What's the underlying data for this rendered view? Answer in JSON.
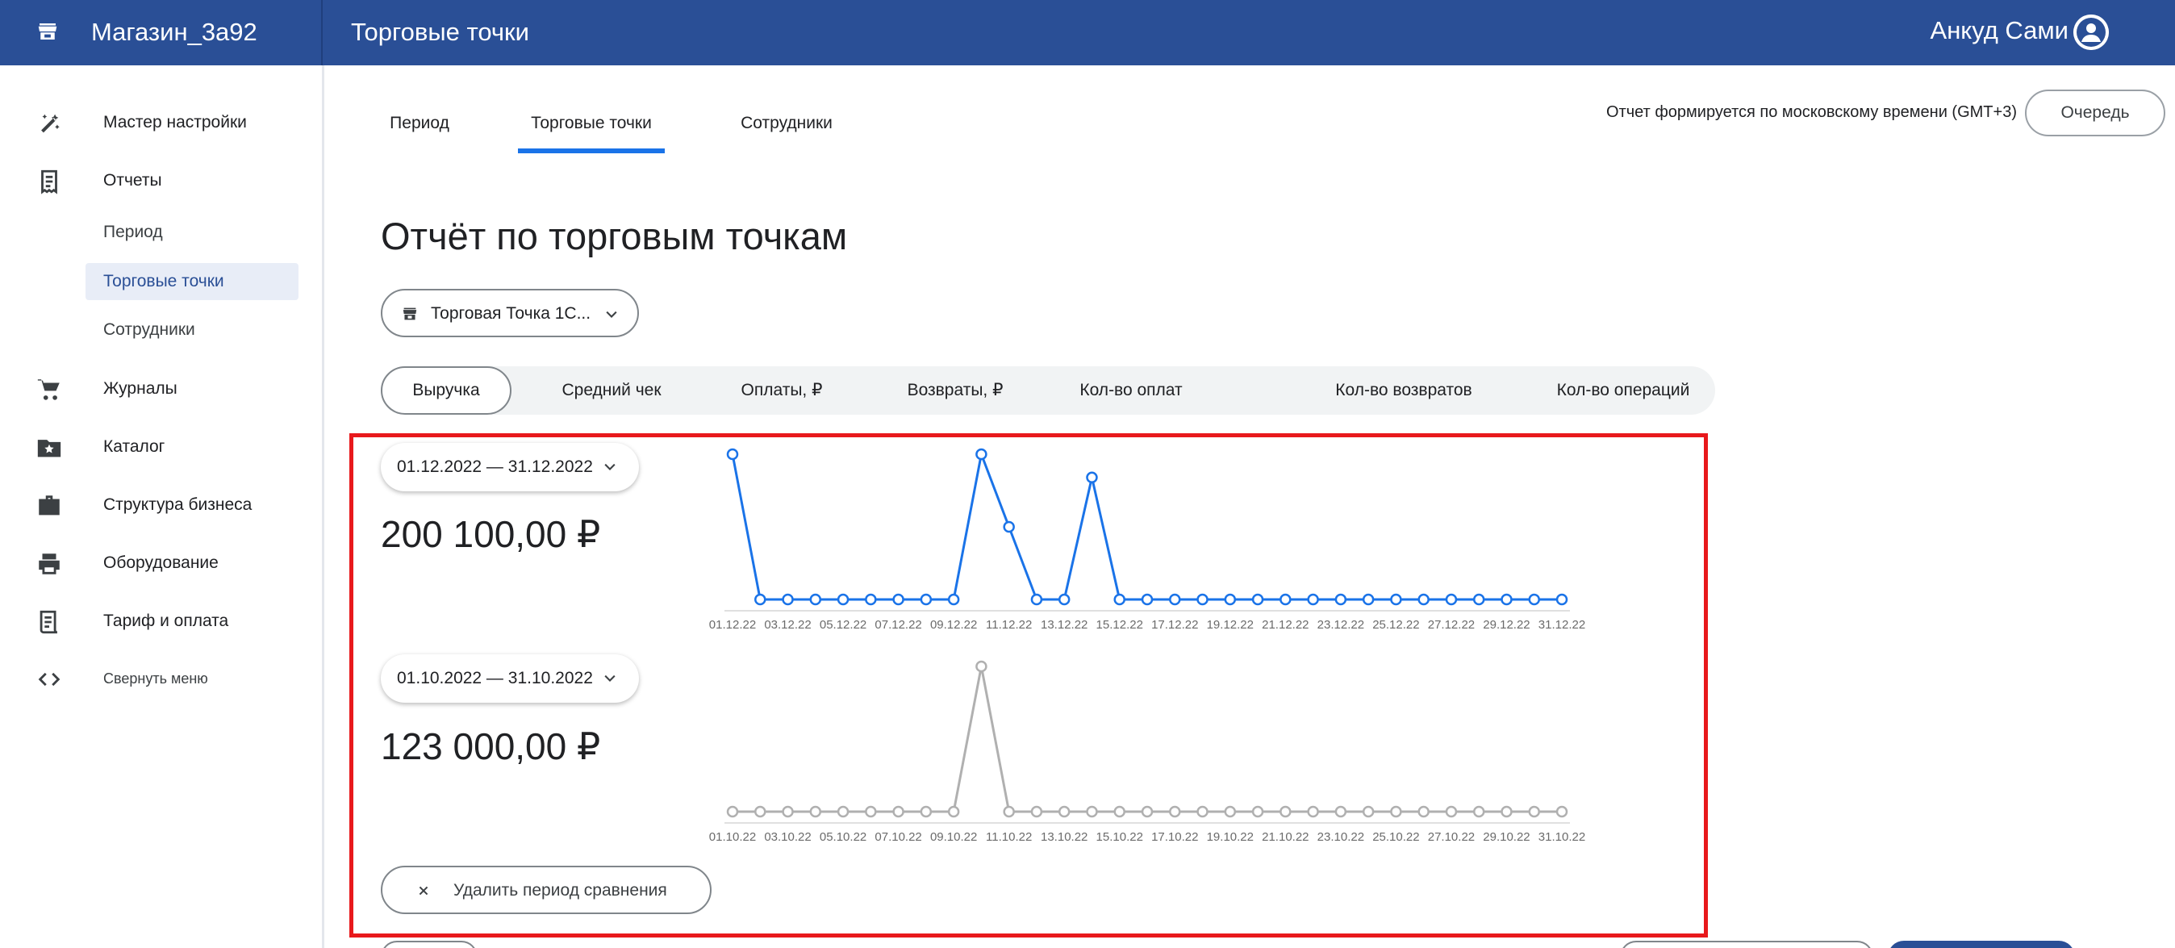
{
  "header": {
    "store_name": "Магазин_3а92",
    "page_title": "Торговые точки",
    "user_name": "Анкуд Сами"
  },
  "sidebar": {
    "items": [
      {
        "label": "Мастер настройки",
        "icon": "magic-wand-icon"
      },
      {
        "label": "Отчеты",
        "icon": "receipt-icon"
      },
      {
        "label": "Журналы",
        "icon": "cart-icon"
      },
      {
        "label": "Каталог",
        "icon": "folder-star-icon"
      },
      {
        "label": "Структура бизнеса",
        "icon": "briefcase-icon"
      },
      {
        "label": "Оборудование",
        "icon": "printer-icon"
      },
      {
        "label": "Тариф и оплата",
        "icon": "invoice-icon"
      }
    ],
    "sub_items": [
      "Период",
      "Торговые точки",
      "Сотрудники"
    ],
    "active_sub_item": "Торговые точки",
    "collapse_label": "Свернуть меню"
  },
  "tabs": [
    "Период",
    "Торговые точки",
    "Сотрудники"
  ],
  "active_tab": "Торговые точки",
  "timezone_note": "Отчет формируется по московскому времени (GMT+3)",
  "queue_button": "Очередь",
  "report_title": "Отчёт по торговым точкам",
  "point_selector": "Торговая Точка 1С...",
  "metrics": [
    "Выручка",
    "Средний чек",
    "Оплаты, ₽",
    "Возвраты, ₽",
    "Кол-во оплат",
    "Кол-во возвратов",
    "Кол-во операций"
  ],
  "active_metric": "Выручка",
  "periods": [
    {
      "range": "01.12.2022 — 31.12.2022",
      "total": "200 100,00 ₽"
    },
    {
      "range": "01.10.2022 — 31.10.2022",
      "total": "123 000,00 ₽"
    }
  ],
  "remove_comparison": "Удалить период сравнения",
  "colors": {
    "header": "#2a4f96",
    "accent": "#1a73e8",
    "highlight": "#e8191c",
    "compare": "#b0b0b0"
  },
  "chart_data": [
    {
      "type": "line",
      "series": [
        {
          "values": [
            1.0,
            0,
            0,
            0,
            0,
            0,
            0,
            0,
            0,
            1.0,
            0.5,
            0,
            0,
            0.84,
            0,
            0,
            0,
            0,
            0,
            0,
            0,
            0,
            0,
            0,
            0,
            0,
            0,
            0,
            0,
            0,
            0
          ]
        }
      ],
      "tick_labels": [
        "01.12.22",
        "03.12.22",
        "05.12.22",
        "07.12.22",
        "09.12.22",
        "11.12.22",
        "13.12.22",
        "15.12.22",
        "17.12.22",
        "19.12.22",
        "21.12.22",
        "23.12.22",
        "25.12.22",
        "27.12.22",
        "29.12.22",
        "31.12.22"
      ],
      "color": "#1a73e8"
    },
    {
      "type": "line",
      "series": [
        {
          "values": [
            0,
            0,
            0,
            0,
            0,
            0,
            0,
            0,
            0,
            1.0,
            0,
            0,
            0,
            0,
            0,
            0,
            0,
            0,
            0,
            0,
            0,
            0,
            0,
            0,
            0,
            0,
            0,
            0,
            0,
            0,
            0
          ]
        }
      ],
      "tick_labels": [
        "01.10.22",
        "03.10.22",
        "05.10.22",
        "07.10.22",
        "09.10.22",
        "11.10.22",
        "13.10.22",
        "15.10.22",
        "17.10.22",
        "19.10.22",
        "21.10.22",
        "23.10.22",
        "25.10.22",
        "27.10.22",
        "29.10.22",
        "31.10.22"
      ],
      "color": "#b0b0b0"
    }
  ]
}
